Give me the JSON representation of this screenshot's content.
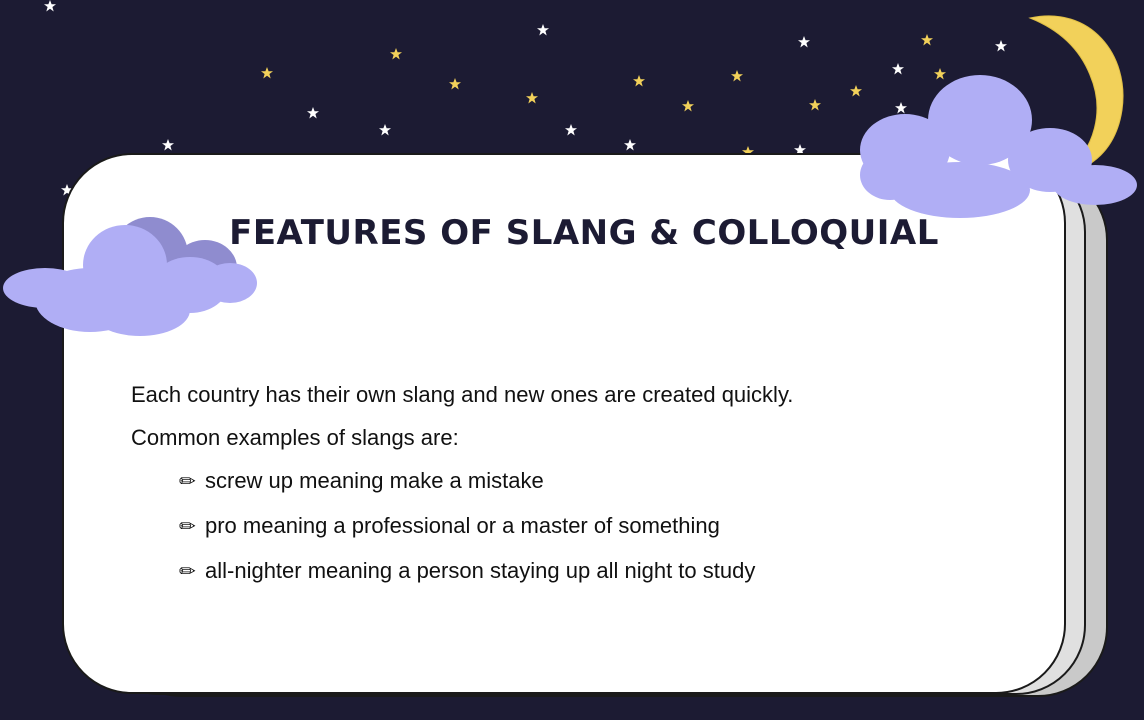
{
  "slide": {
    "title": "FEATURES OF SLANG & COLLOQUIAL",
    "intro_lines": [
      "Each country has their own slang and new ones are created quickly.",
      "Common examples of slangs are:"
    ],
    "bullets": [
      "screw up meaning make a mistake",
      "pro meaning a professional or a master of something",
      "all-nighter meaning a person staying up all night to study"
    ],
    "bullet_icon": "pencil-icon",
    "bullet_glyph": "✏"
  },
  "colors": {
    "background": "#1c1b33",
    "card": "#ffffff",
    "title": "#1c1b33",
    "cloud": "#b0aef5",
    "cloud_shade": "#8f8ccf",
    "moon": "#f2d15a",
    "star_white": "#ffffff",
    "star_yellow": "#f2d15a"
  }
}
